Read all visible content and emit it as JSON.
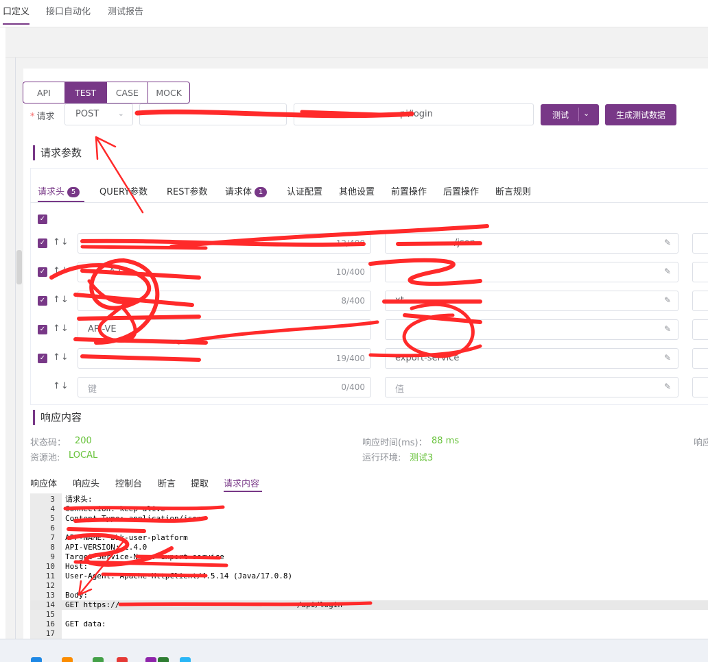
{
  "top_tabs": [
    "口定义",
    "接口自动化",
    "测试报告"
  ],
  "mode_tabs": [
    "API",
    "TEST",
    "CASE",
    "MOCK"
  ],
  "request": {
    "label": "请求",
    "method": "POST",
    "url_suffix": "pi/login",
    "test_button": "测试",
    "generate_button": "生成测试数据"
  },
  "section_params": "请求参数",
  "param_tabs": [
    {
      "label": "请求头",
      "badge": "5"
    },
    {
      "label": "QUERY参数"
    },
    {
      "label": "REST参数"
    },
    {
      "label": "请求体",
      "badge": "1"
    },
    {
      "label": "认证配置"
    },
    {
      "label": "其他设置"
    },
    {
      "label": "前置操作"
    },
    {
      "label": "后置操作"
    },
    {
      "label": "断言规则"
    }
  ],
  "headers": [
    {
      "key": "",
      "key_count": "12/400",
      "value": "/json"
    },
    {
      "key": "A-DI",
      "key_count": "10/400",
      "value": ""
    },
    {
      "key": "",
      "key_count": "8/400",
      "value": "xt"
    },
    {
      "key": "API-VE",
      "key_count": "",
      "value": ""
    },
    {
      "key": "",
      "key_count": "19/400",
      "value": "export-service"
    }
  ],
  "new_row": {
    "key_placeholder": "键",
    "key_count": "0/400",
    "value_placeholder": "值"
  },
  "section_response": "响应内容",
  "response": {
    "status_label": "状态码：",
    "status_value": "200",
    "time_label": "响应时间(ms)：",
    "time_value": "88 ms",
    "pool_label": "资源池:",
    "pool_value": "LOCAL",
    "env_label": "运行环境:",
    "env_value": "测试3",
    "right_label": "响应"
  },
  "response_tabs": [
    "响应体",
    "响应头",
    "控制台",
    "断言",
    "提取",
    "请求内容"
  ],
  "code_lines": [
    {
      "n": "3",
      "t": "请求头:"
    },
    {
      "n": "4",
      "t": "Connection: keep-alive"
    },
    {
      "n": "5",
      "t": "Content-Type: application/json"
    },
    {
      "n": "6",
      "t": ""
    },
    {
      "n": "7",
      "t": "APP-NAME: bbk-user-platform"
    },
    {
      "n": "8",
      "t": "API-VERSION: 1.4.0"
    },
    {
      "n": "9",
      "t": "Target-Service-Name: export-service"
    },
    {
      "n": "10",
      "t": "Host:"
    },
    {
      "n": "11",
      "t": "User-Agent: Apache-HttpClient/4.5.14 (Java/17.0.8)"
    },
    {
      "n": "12",
      "t": ""
    },
    {
      "n": "13",
      "t": "Body:"
    },
    {
      "n": "14",
      "t": "GET https://                                       /api/login"
    },
    {
      "n": "15",
      "t": ""
    },
    {
      "n": "16",
      "t": "GET data:"
    },
    {
      "n": "17",
      "t": ""
    }
  ],
  "colors": {
    "accent": "#783887",
    "success": "#67c23a",
    "scribble": "#ff2a2a"
  }
}
